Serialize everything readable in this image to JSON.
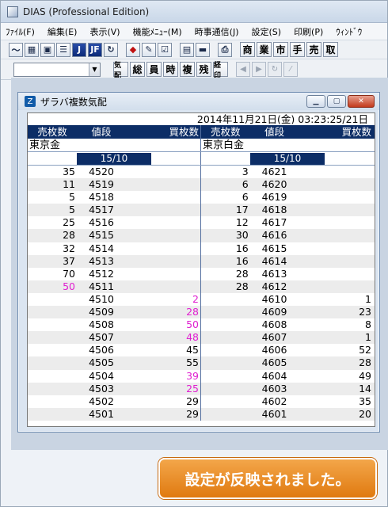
{
  "window": {
    "title": "DIAS (Professional Edition)"
  },
  "menu": [
    "ﾌｧｲﾙ(F)",
    "編集(E)",
    "表示(V)",
    "機能ﾒﾆｭｰ(M)",
    "時事通信(J)",
    "設定(S)",
    "印刷(P)",
    "ｳｨﾝﾄﾞｳ"
  ],
  "toolbar": {
    "icons": [
      "chart-icon",
      "multi-chart-icon",
      "window-icon",
      "list-icon",
      "j-icon",
      "jf-icon",
      "refresh-icon",
      "bell-icon",
      "edit-icon",
      "check-icon",
      "doc-icon",
      "monitor-icon",
      "printer-icon"
    ],
    "text_buttons": [
      "商",
      "業",
      "市",
      "手",
      "売",
      "取"
    ]
  },
  "toolbar2": {
    "combo_value": "",
    "text_buttons": [
      "気配",
      "総",
      "員",
      "時",
      "複",
      "残",
      "経印"
    ]
  },
  "child_window": {
    "title": "ザラバ複数気配",
    "datetime": "2014年11月21日(金) 03:23:25/21日",
    "headers": {
      "sell_qty": "売枚数",
      "price": "値段",
      "buy_qty": "買枚数"
    },
    "left": {
      "name": "東京金",
      "month": "15/10",
      "rows": [
        {
          "sell": "35",
          "price": "4520",
          "buy": ""
        },
        {
          "sell": "11",
          "price": "4519",
          "buy": ""
        },
        {
          "sell": "5",
          "price": "4518",
          "buy": ""
        },
        {
          "sell": "5",
          "price": "4517",
          "buy": ""
        },
        {
          "sell": "25",
          "price": "4516",
          "buy": ""
        },
        {
          "sell": "28",
          "price": "4515",
          "buy": ""
        },
        {
          "sell": "32",
          "price": "4514",
          "buy": ""
        },
        {
          "sell": "37",
          "price": "4513",
          "buy": ""
        },
        {
          "sell": "70",
          "price": "4512",
          "buy": ""
        },
        {
          "sell": "50",
          "price": "4511",
          "buy": "",
          "sell_highlight": true
        },
        {
          "sell": "",
          "price": "4510",
          "buy": "2",
          "buy_highlight": true
        },
        {
          "sell": "",
          "price": "4509",
          "buy": "28",
          "buy_highlight": true
        },
        {
          "sell": "",
          "price": "4508",
          "buy": "50",
          "buy_highlight": true
        },
        {
          "sell": "",
          "price": "4507",
          "buy": "48",
          "buy_highlight": true
        },
        {
          "sell": "",
          "price": "4506",
          "buy": "45"
        },
        {
          "sell": "",
          "price": "4505",
          "buy": "55"
        },
        {
          "sell": "",
          "price": "4504",
          "buy": "39",
          "buy_highlight": true
        },
        {
          "sell": "",
          "price": "4503",
          "buy": "25",
          "buy_highlight": true
        },
        {
          "sell": "",
          "price": "4502",
          "buy": "29"
        },
        {
          "sell": "",
          "price": "4501",
          "buy": "29"
        }
      ]
    },
    "right": {
      "name": "東京白金",
      "month": "15/10",
      "rows": [
        {
          "sell": "3",
          "price": "4621",
          "buy": ""
        },
        {
          "sell": "6",
          "price": "4620",
          "buy": ""
        },
        {
          "sell": "6",
          "price": "4619",
          "buy": ""
        },
        {
          "sell": "17",
          "price": "4618",
          "buy": ""
        },
        {
          "sell": "12",
          "price": "4617",
          "buy": ""
        },
        {
          "sell": "30",
          "price": "4616",
          "buy": ""
        },
        {
          "sell": "16",
          "price": "4615",
          "buy": ""
        },
        {
          "sell": "16",
          "price": "4614",
          "buy": ""
        },
        {
          "sell": "28",
          "price": "4613",
          "buy": ""
        },
        {
          "sell": "28",
          "price": "4612",
          "buy": ""
        },
        {
          "sell": "",
          "price": "4610",
          "buy": "1"
        },
        {
          "sell": "",
          "price": "4609",
          "buy": "23"
        },
        {
          "sell": "",
          "price": "4608",
          "buy": "8"
        },
        {
          "sell": "",
          "price": "4607",
          "buy": "1"
        },
        {
          "sell": "",
          "price": "4606",
          "buy": "52"
        },
        {
          "sell": "",
          "price": "4605",
          "buy": "28"
        },
        {
          "sell": "",
          "price": "4604",
          "buy": "49"
        },
        {
          "sell": "",
          "price": "4603",
          "buy": "14"
        },
        {
          "sell": "",
          "price": "4602",
          "buy": "35"
        },
        {
          "sell": "",
          "price": "4601",
          "buy": "20"
        }
      ]
    }
  },
  "toast": {
    "message": "設定が反映されました。"
  },
  "colors": {
    "header_bg": "#0c2d66",
    "highlight": "#e020d0",
    "toast": "#e88a20"
  }
}
